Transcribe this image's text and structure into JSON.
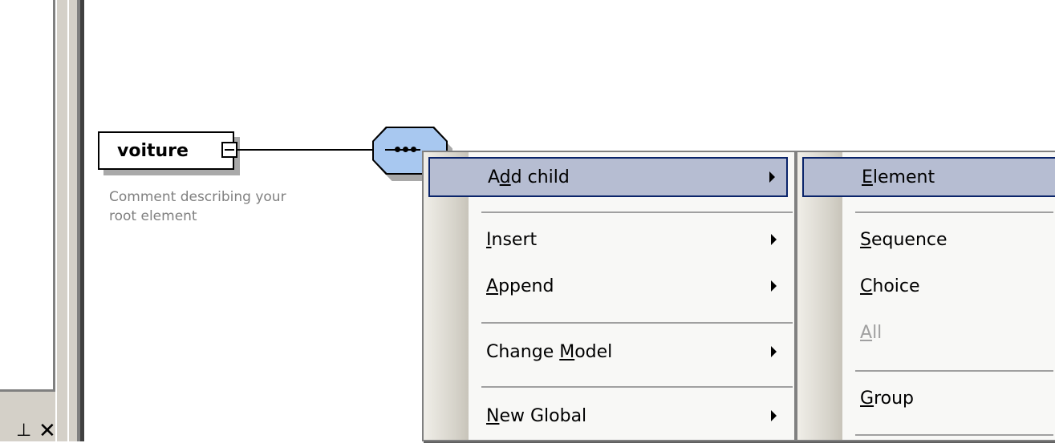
{
  "diagram": {
    "root_element": "voiture",
    "comment_line1": "Comment describing your",
    "comment_line2": "root element"
  },
  "menu_main": {
    "items": [
      {
        "pre": "A",
        "u": "d",
        "post": "d child",
        "arrow": true,
        "selected": true
      },
      {
        "pre": "",
        "u": "I",
        "post": "nsert",
        "arrow": true
      },
      {
        "pre": "",
        "u": "A",
        "post": "ppend",
        "arrow": true
      },
      {
        "pre": "Change ",
        "u": "M",
        "post": "odel",
        "arrow": true
      },
      {
        "pre": "",
        "u": "N",
        "post": "ew Global",
        "arrow": true
      }
    ]
  },
  "menu_sub": {
    "items": [
      {
        "pre": "",
        "u": "E",
        "post": "lement",
        "selected": true
      },
      {
        "pre": "",
        "u": "S",
        "post": "equence"
      },
      {
        "pre": "",
        "u": "C",
        "post": "hoice"
      },
      {
        "pre": "",
        "u": "A",
        "post": "ll",
        "disabled": true
      },
      {
        "pre": "",
        "u": "G",
        "post": "roup"
      }
    ]
  },
  "panel": {
    "pin_glyph": "⊥",
    "close_glyph": "✕"
  }
}
